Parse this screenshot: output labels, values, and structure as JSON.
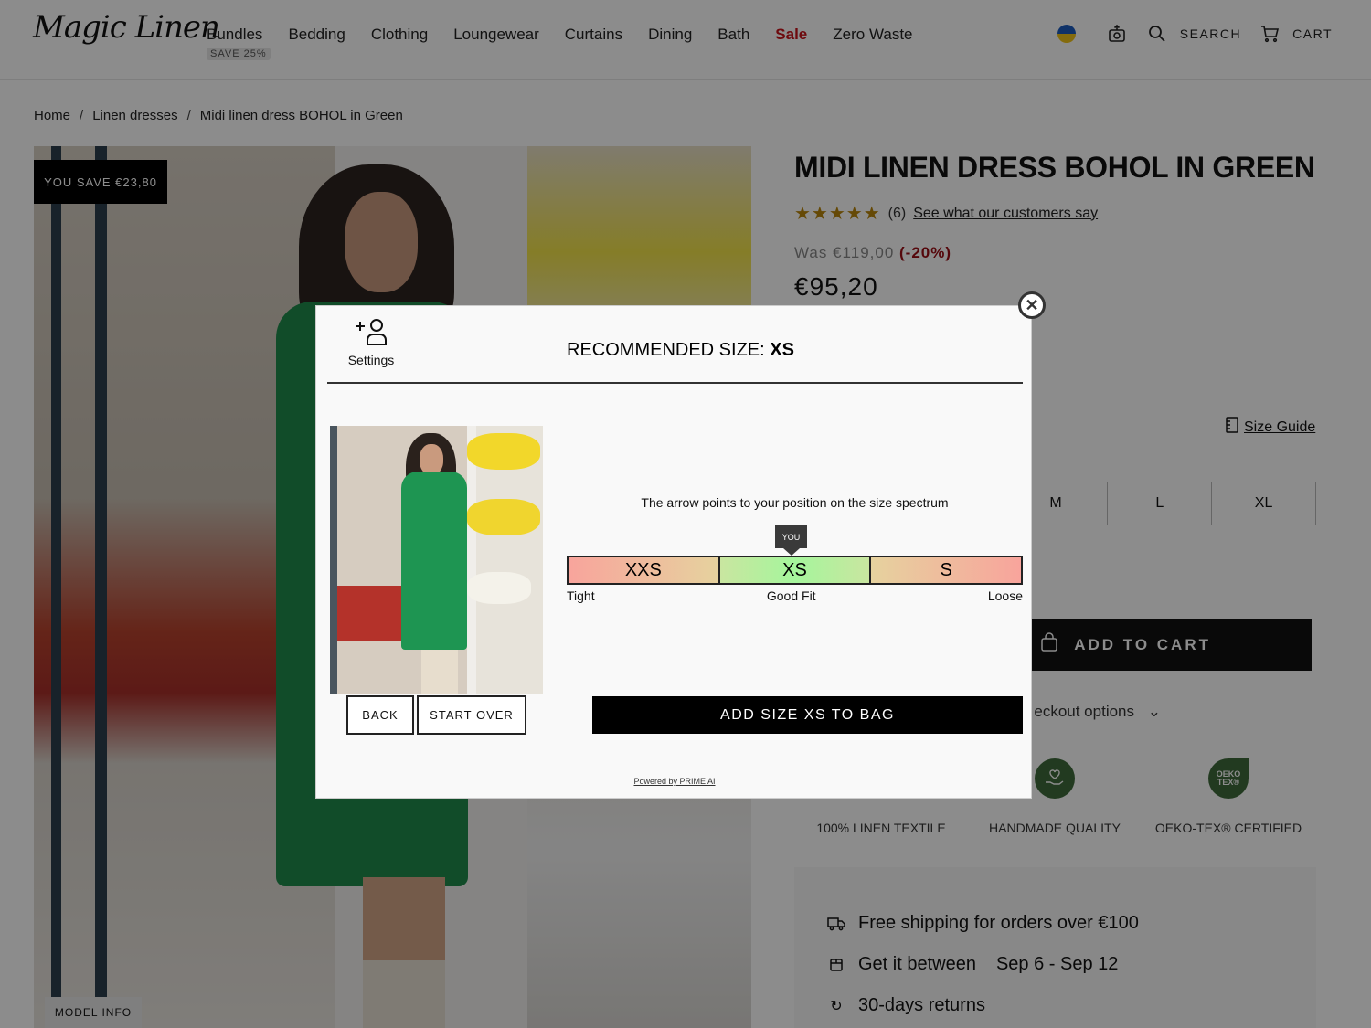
{
  "header": {
    "logo": "Magic Linen",
    "nav": [
      {
        "label": "Bundles",
        "badge": "SAVE 25%"
      },
      {
        "label": "Bedding"
      },
      {
        "label": "Clothing"
      },
      {
        "label": "Loungewear"
      },
      {
        "label": "Curtains"
      },
      {
        "label": "Dining"
      },
      {
        "label": "Bath"
      },
      {
        "label": "Sale",
        "highlight": true
      },
      {
        "label": "Zero Waste"
      }
    ],
    "search_label": "SEARCH",
    "cart_label": "CART",
    "icons": [
      "ukraine-flag-icon",
      "camera-upload-icon",
      "search-icon",
      "cart-icon"
    ]
  },
  "breadcrumb": [
    "Home",
    "Linen dresses",
    "Midi linen dress BOHOL in Green"
  ],
  "breadcrumb_separator": "/",
  "gallery": {
    "save_badge": "YOU SAVE €23,80",
    "model_info": "MODEL INFO"
  },
  "product": {
    "title": "MIDI LINEN DRESS BOHOL IN GREEN",
    "stars": "★★★★★",
    "rating": 5,
    "reviews_count": "(6)",
    "reviews_link": "See what our customers say",
    "was_price": "Was €119,00",
    "discount": "(-20%)",
    "price": "€95,20",
    "size_guide": "Size Guide",
    "sizes_visible": [
      "M",
      "L",
      "XL"
    ],
    "add_to_cart": "ADD TO CART",
    "checkout_options": "eckout options",
    "features": [
      {
        "label": "100% LINEN TEXTILE",
        "icon": "linen-icon"
      },
      {
        "label": "HANDMADE QUALITY",
        "icon": "hand-heart-icon"
      },
      {
        "label": "OEKO-TEX® CERTIFIED",
        "icon": "oeko-tex-icon",
        "icon_text": "OEKO TEX®"
      }
    ],
    "info": [
      {
        "icon": "truck-icon",
        "text": "Free shipping for orders over €100"
      },
      {
        "icon": "box-icon",
        "text": "Get it between",
        "date": "Sep 6 - Sep 12"
      },
      {
        "icon": "return-icon",
        "text": "30-days returns"
      }
    ]
  },
  "modal": {
    "settings_label": "Settings",
    "recommended_prefix": "RECOMMENDED SIZE:",
    "recommended_size": "XS",
    "spectrum_caption": "The arrow points to your position on the size spectrum",
    "you_label": "YOU",
    "spectrum_sizes": [
      "XXS",
      "XS",
      "S"
    ],
    "spectrum_position": "XS",
    "spectrum_labels": [
      "Tight",
      "Good Fit",
      "Loose"
    ],
    "back_label": "BACK",
    "start_over_label": "START OVER",
    "add_to_bag_label": "ADD SIZE XS TO BAG",
    "powered_by": "Powered by PRIME AI",
    "colors": {
      "tight": "#f8a49c",
      "good_fit": "#a5f59c",
      "marker": "#3a3a3a"
    }
  }
}
